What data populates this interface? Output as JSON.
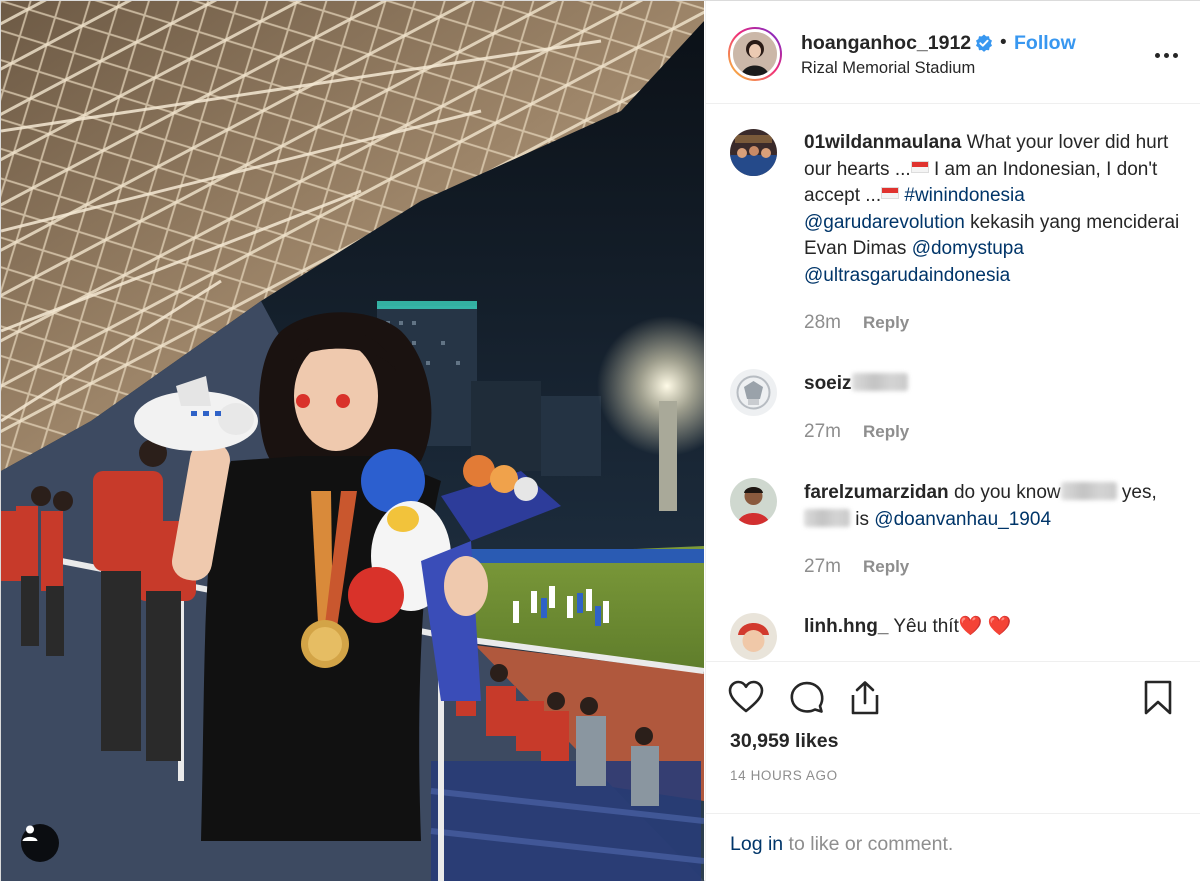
{
  "post": {
    "username": "hoanganhoc_1912",
    "separator": "•",
    "follow_label": "Follow",
    "location": "Rizal Memorial Stadium",
    "verified_icon": "verified-badge-icon",
    "accent_color": "#3897f0"
  },
  "comments": [
    {
      "username": "01wildanmaulana",
      "text_1": "What your lover did hurt our hearts ...",
      "text_2": " I am an Indonesian, I don't accept ...",
      "hashtag": "#winindonesia",
      "mention_1": "@garudarevolution",
      "text_3": " kekasih yang menciderai Evan Dimas ",
      "mention_2": "@domystupa",
      "mention_3": "@ultrasgarudaindonesia",
      "time": "28m",
      "reply_label": "Reply"
    },
    {
      "username": "soeiz",
      "time": "27m",
      "reply_label": "Reply"
    },
    {
      "username": "farelzumarzidan",
      "text_1": "do you know",
      "text_2": " yes,",
      "text_3": " is ",
      "mention_1": "@doanvanhau_1904",
      "time": "27m",
      "reply_label": "Reply"
    },
    {
      "username": "linh.hng_",
      "text_1": "Yêu thít",
      "emoji": "❤️ ❤️"
    }
  ],
  "actions": {
    "like_icon": "heart-icon",
    "comment_icon": "comment-icon",
    "share_icon": "share-icon",
    "save_icon": "bookmark-icon"
  },
  "likes": "30,959 likes",
  "timestamp": "14 HOURS AGO",
  "login": {
    "link_text": "Log in",
    "rest_text": " to like or comment."
  },
  "photo": {
    "tag_icon": "user-tag-icon"
  }
}
